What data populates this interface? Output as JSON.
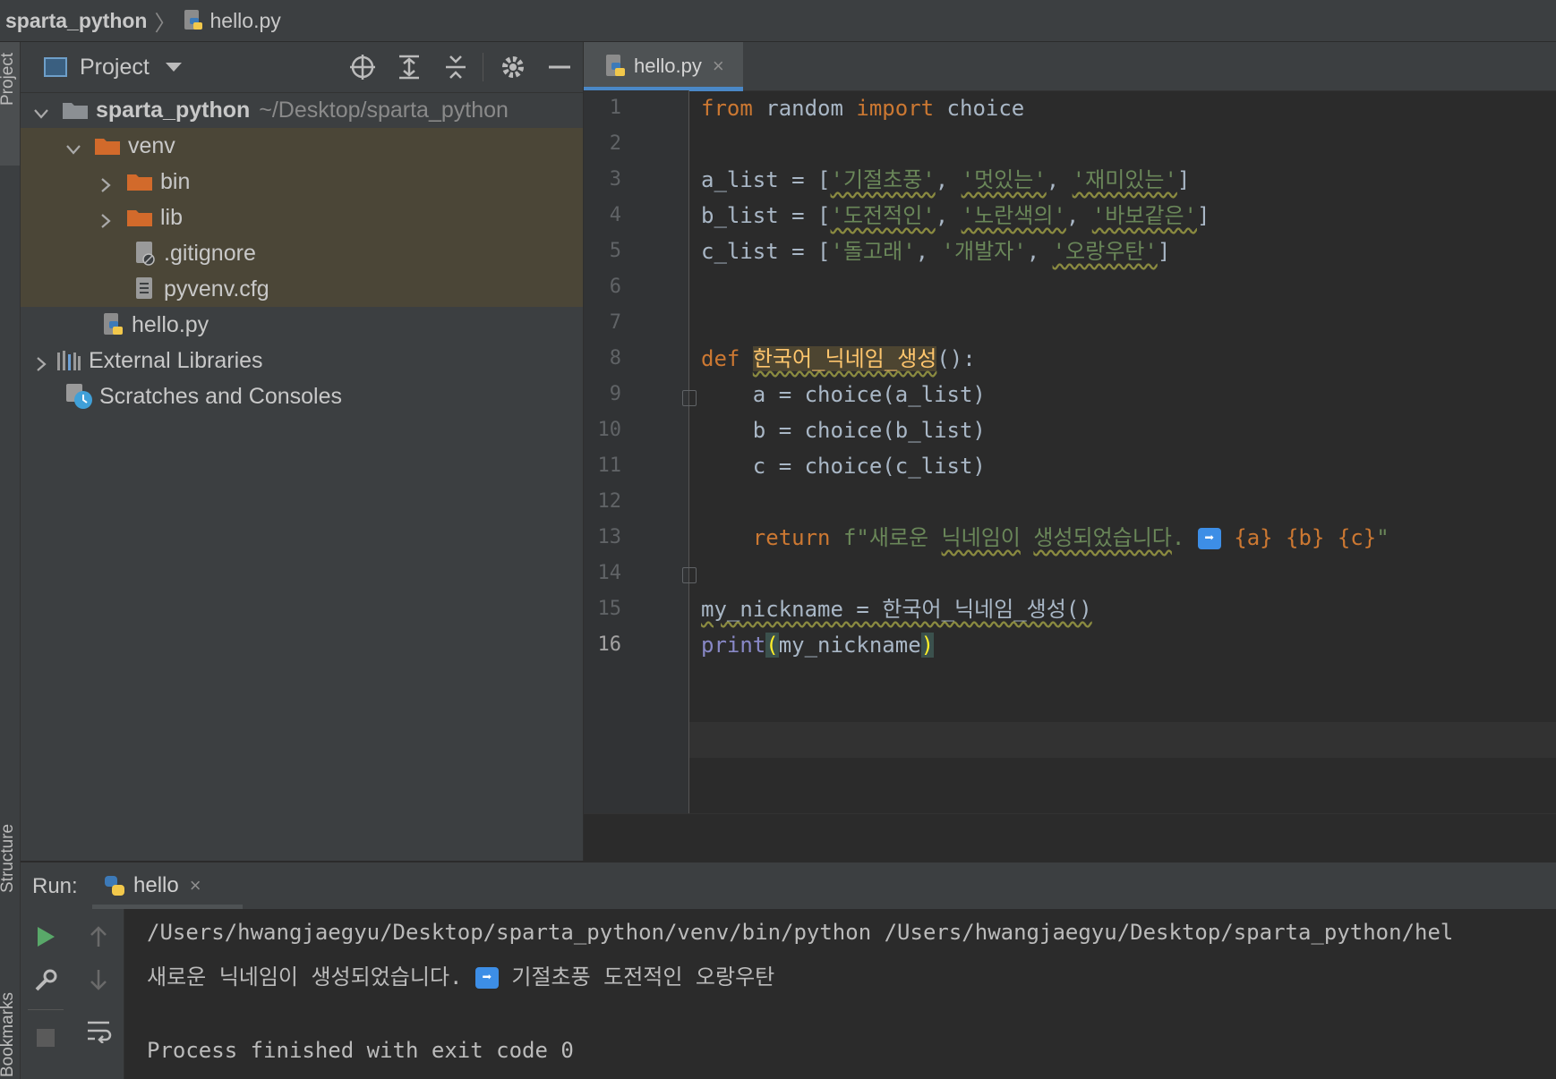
{
  "breadcrumb": {
    "project": "sparta_python",
    "file": "hello.py"
  },
  "left_strip": {
    "project_label": "Project",
    "structure_label": "Structure",
    "bookmarks_label": "Bookmarks"
  },
  "project_panel": {
    "title": "Project",
    "tree": [
      {
        "label": "sparta_python",
        "path": "~/Desktop/sparta_python"
      },
      {
        "label": "venv"
      },
      {
        "label": "bin"
      },
      {
        "label": "lib"
      },
      {
        "label": ".gitignore"
      },
      {
        "label": "pyvenv.cfg"
      },
      {
        "label": "hello.py"
      },
      {
        "label": "External Libraries"
      },
      {
        "label": "Scratches and Consoles"
      }
    ]
  },
  "editor": {
    "tab_label": "hello.py",
    "tab_close": "×",
    "current_line": 16,
    "line_numbers": [
      "1",
      "2",
      "3",
      "4",
      "5",
      "6",
      "7",
      "8",
      "9",
      "10",
      "11",
      "12",
      "13",
      "14",
      "15",
      "16"
    ],
    "code": {
      "l1_from": "from",
      "l1_module": " random ",
      "l1_import": "import",
      "l1_name": " choice",
      "l3_var": "a_list = [",
      "l3_s1": "'기절초풍'",
      "l3_s2": "'멋있는'",
      "l3_s3": "'재미있는'",
      "l4_var": "b_list = [",
      "l4_s1": "'도전적인'",
      "l4_s2": "'노란색의'",
      "l4_s3": "'바보같은'",
      "l5_var": "c_list = [",
      "l5_s1": "'돌고래'",
      "l5_s2": "'개발자'",
      "l5_s3": "'오랑우탄'",
      "sep": ", ",
      "close_bracket": "]",
      "l8_def": "def",
      "l8_name": "한국어_닉네임_생성",
      "l8_tail": "():",
      "l9": "    a = choice(a_list)",
      "l10": "    b = choice(b_list)",
      "l11": "    c = choice(c_list)",
      "l13_indent": "    ",
      "l13_return": "return",
      "l13_f": " f\"새로운 ",
      "l13_w1": "닉네임이",
      "l13_sp": " ",
      "l13_w2": "생성되었습니다",
      "l13_dot": ". ",
      "l13_emoji": "➡",
      "l13_a": " {a}",
      "l13_b": " {b}",
      "l13_c": " {c}",
      "l13_end": "\"",
      "l15_var": "my_nickname = 한국어_닉네임_생성()",
      "l16_print": "print",
      "l16_open": "(",
      "l16_arg": "my_nickname",
      "l16_close": ")"
    }
  },
  "run": {
    "label": "Run:",
    "tab_label": "hello",
    "tab_close": "×",
    "console": {
      "line1": "/Users/hwangjaegyu/Desktop/sparta_python/venv/bin/python /Users/hwangjaegyu/Desktop/sparta_python/hel",
      "line2_pre": "새로운 닉네임이 생성되었습니다. ",
      "line2_emoji": "➡",
      "line2_post": " 기절초풍 도전적인 오랑우탄",
      "line4": "Process finished with exit code 0"
    }
  },
  "colors": {
    "accent": "#4a88c7",
    "keyword": "#cc7832",
    "string": "#6a8759",
    "function": "#ffc66d",
    "builtin": "#8888c6"
  },
  "icons": [
    "python-file-icon",
    "folder-icon",
    "chevron-down-icon",
    "chevron-right-icon",
    "locate-icon",
    "expand-all-icon",
    "collapse-all-icon",
    "gear-icon",
    "minimize-icon",
    "libraries-icon",
    "scratches-icon",
    "run-icon",
    "wrench-icon",
    "stop-icon",
    "up-arrow-icon",
    "down-arrow-icon",
    "soft-wrap-icon",
    "close-icon"
  ]
}
